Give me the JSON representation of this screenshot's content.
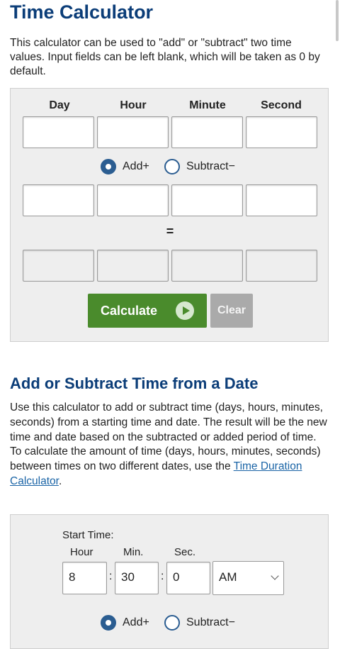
{
  "page": {
    "title": "Time Calculator",
    "intro": "This calculator can be used to \"add\" or \"subtract\" two time values. Input fields can be left blank, which will be taken as 0 by default."
  },
  "calc1": {
    "columns": [
      "Day",
      "Hour",
      "Minute",
      "Second"
    ],
    "op_add": "Add+",
    "op_sub": "Subtract−",
    "selected_op": "add",
    "equals": "=",
    "calculate_label": "Calculate",
    "calculate_icon": "play-icon",
    "clear_label": "Clear"
  },
  "section2": {
    "title": "Add or Subtract Time from a Date",
    "desc": "Use this calculator to add or subtract time (days, hours, minutes, seconds) from a starting time and date. The result will be the new time and date based on the subtracted or added period of time. To calculate the amount of time (days, hours, minutes, seconds) between times on two different dates, use the",
    "link_text": "Time Duration Calculator",
    "desc_end": "."
  },
  "calc2": {
    "start_label": "Start Time:",
    "hour_label": "Hour",
    "min_label": "Min.",
    "sec_label": "Sec.",
    "hour": "8",
    "minute": "30",
    "second": "0",
    "ampm": "AM",
    "separator": ":",
    "op_add": "Add+",
    "op_sub": "Subtract−"
  },
  "colors": {
    "heading": "#0b3d78",
    "calculate": "#4a8b2c",
    "clear": "#aaaaaa",
    "radio": "#2b5d91",
    "link": "#1a64a6"
  }
}
